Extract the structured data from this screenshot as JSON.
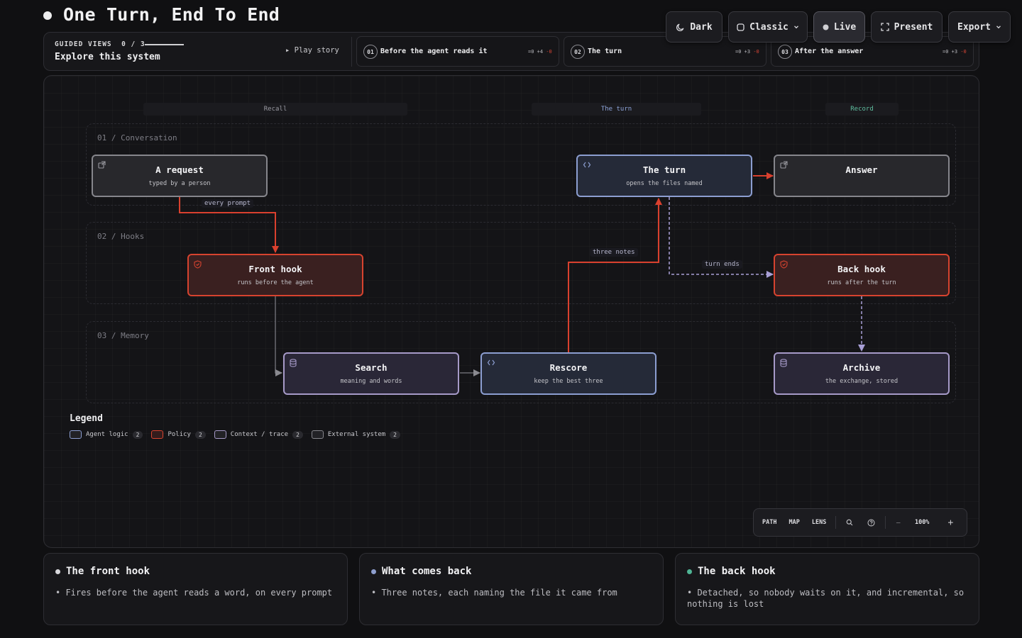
{
  "page": {
    "title": "One Turn, End To End"
  },
  "toolbar": {
    "theme_label": "Dark",
    "style_label": "Classic",
    "live_label": "Live",
    "present_label": "Present",
    "export_label": "Export"
  },
  "guided": {
    "label": "GUIDED VIEWS  0 / 3",
    "subtitle": "Explore this system",
    "play_label": "▸ Play story",
    "steps": [
      {
        "num": "01",
        "title": "Before the agent reads it",
        "stat_eq": "=0",
        "stat_add": "+4",
        "stat_del": "-0"
      },
      {
        "num": "02",
        "title": "The turn",
        "stat_eq": "=0",
        "stat_add": "+3",
        "stat_del": "-0"
      },
      {
        "num": "03",
        "title": "After the answer",
        "stat_eq": "=0",
        "stat_add": "+3",
        "stat_del": "-0"
      }
    ]
  },
  "columns": [
    {
      "label": "Recall",
      "color": "#9a9aa2"
    },
    {
      "label": "The turn",
      "color": "#8ea4da"
    },
    {
      "label": "Record",
      "color": "#5fbfa0"
    }
  ],
  "lanes": [
    {
      "label": "01 / Conversation"
    },
    {
      "label": "02 / Hooks"
    },
    {
      "label": "03 / Memory"
    }
  ],
  "nodes": {
    "request": {
      "title": "A request",
      "sub": "typed by a person"
    },
    "turn": {
      "title": "The turn",
      "sub": "opens the files named"
    },
    "answer": {
      "title": "Answer",
      "sub": ""
    },
    "front_hook": {
      "title": "Front hook",
      "sub": "runs before the agent"
    },
    "back_hook": {
      "title": "Back hook",
      "sub": "runs after the turn"
    },
    "search": {
      "title": "Search",
      "sub": "meaning and words"
    },
    "rescore": {
      "title": "Rescore",
      "sub": "keep the best three"
    },
    "archive": {
      "title": "Archive",
      "sub": "the exchange, stored"
    }
  },
  "edges": {
    "every_prompt": "every prompt",
    "three_notes": "three notes",
    "turn_ends": "turn ends"
  },
  "legend": {
    "title": "Legend",
    "items": [
      {
        "label": "Agent logic",
        "count": "2",
        "color": "#8c9ed1"
      },
      {
        "label": "Policy",
        "count": "2",
        "color": "#d7432f"
      },
      {
        "label": "Context / trace",
        "count": "2",
        "color": "#a69ac8"
      },
      {
        "label": "External system",
        "count": "2",
        "color": "#86868c"
      }
    ]
  },
  "controls": {
    "path": "PATH",
    "map": "MAP",
    "lens": "LENS",
    "minus": "−",
    "zoom": "100%",
    "plus": "+"
  },
  "cards": [
    {
      "title": "The front hook",
      "body": "• Fires before the agent reads a word, on every prompt",
      "dot": "#d8d8dc"
    },
    {
      "title": "What comes back",
      "body": "• Three notes, each naming the file it came from",
      "dot": "#8e9fce"
    },
    {
      "title": "The back hook",
      "body": "• Detached, so nobody waits on it, and incremental, so nothing is lost",
      "dot": "#4fb595"
    }
  ]
}
